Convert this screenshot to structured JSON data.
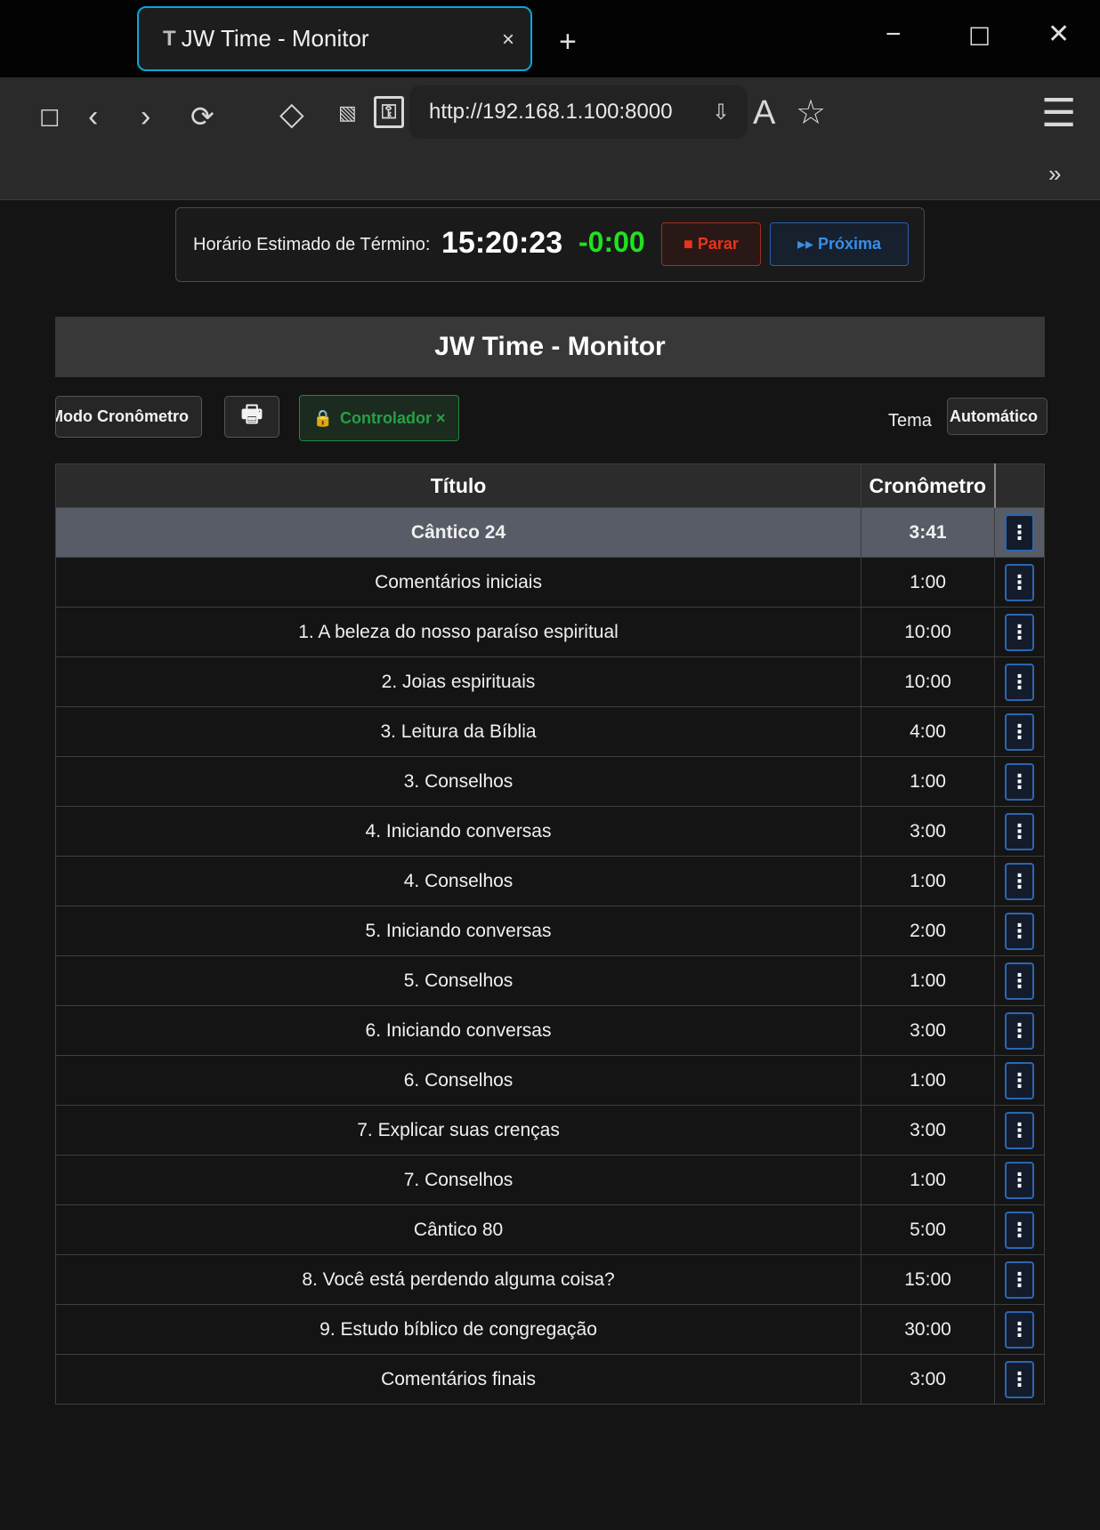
{
  "browser": {
    "tab_icon": "T",
    "tab_title": "JW Time - Monitor",
    "tab_close": "×",
    "new_tab": "+",
    "url": "http://192.168.1.100:8000",
    "overflow": "»"
  },
  "status": {
    "label": "Horário Estimado de Término:",
    "end_time": "15:20:23",
    "diff": "-0:00",
    "stop_label": "■ Parar",
    "next_label": "▸▸ Próxima"
  },
  "page": {
    "title": "JW Time - Monitor"
  },
  "controls": {
    "mode_label": "Modo Cronômetro",
    "controller_label": "Controlador ×",
    "theme_label": "Tema",
    "theme_value": "Automático"
  },
  "table": {
    "col_title": "Título",
    "col_timer": "Cronômetro",
    "rows": [
      {
        "title": "Cântico 24",
        "time": "3:41"
      },
      {
        "title": "Comentários iniciais",
        "time": "1:00"
      },
      {
        "title": "1. A beleza do nosso paraíso espiritual",
        "time": "10:00"
      },
      {
        "title": "2. Joias espirituais",
        "time": "10:00"
      },
      {
        "title": "3. Leitura da Bíblia",
        "time": "4:00"
      },
      {
        "title": "3. Conselhos",
        "time": "1:00"
      },
      {
        "title": "4. Iniciando conversas",
        "time": "3:00"
      },
      {
        "title": "4. Conselhos",
        "time": "1:00"
      },
      {
        "title": "5. Iniciando conversas",
        "time": "2:00"
      },
      {
        "title": "5. Conselhos",
        "time": "1:00"
      },
      {
        "title": "6. Iniciando conversas",
        "time": "3:00"
      },
      {
        "title": "6. Conselhos",
        "time": "1:00"
      },
      {
        "title": "7. Explicar suas crenças",
        "time": "3:00"
      },
      {
        "title": "7. Conselhos",
        "time": "1:00"
      },
      {
        "title": "Cântico 80",
        "time": "5:00"
      },
      {
        "title": "8. Você está perdendo alguma coisa?",
        "time": "15:00"
      },
      {
        "title": "9. Estudo bíblico de congregação",
        "time": "30:00"
      },
      {
        "title": "Comentários finais",
        "time": "3:00"
      }
    ],
    "current_row": 0
  }
}
